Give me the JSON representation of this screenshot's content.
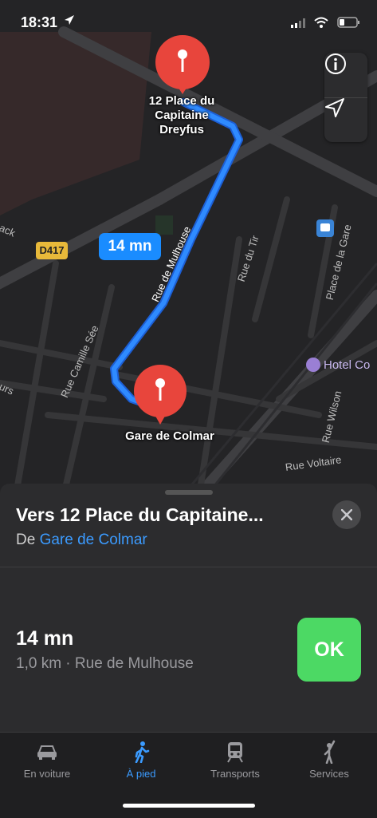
{
  "status_bar": {
    "time": "18:31"
  },
  "map": {
    "destination_pin_label": "12 Place du Capitaine Dreyfus",
    "destination_pin_lines": [
      "12 Place du",
      "Capitaine",
      "Dreyfus"
    ],
    "origin_pin_label": "Gare de Colmar",
    "route_time_bubble": "14 mn",
    "road_badge": "D417",
    "streets": {
      "rue_de_mulhouse": "Rue de Mulhouse",
      "rue_du_tir": "Rue du Tir",
      "place_de_la_gare": "Place de la Gare",
      "rue_camille_see": "Rue Camille Sée",
      "rue_wilson": "Rue Wilson",
      "rue_voltaire": "Rue Voltaire",
      "partial_left": "ack",
      "partial_left2": "urs"
    },
    "poi_hotel": "Hotel Co",
    "buttons": {
      "info_icon": "info-icon",
      "location_icon": "location-arrow-icon"
    }
  },
  "sheet": {
    "title": "Vers 12 Place du Capitaine...",
    "from_prefix": "De",
    "from_link": "Gare de Colmar",
    "duration": "14 mn",
    "detail": "1,0 km · Rue de Mulhouse",
    "ok_label": "OK"
  },
  "tabs": [
    {
      "label": "En voiture",
      "icon": "car-icon",
      "active": false
    },
    {
      "label": "À pied",
      "icon": "walk-icon",
      "active": true
    },
    {
      "label": "Transports",
      "icon": "train-icon",
      "active": false
    },
    {
      "label": "Services",
      "icon": "person-hailing-icon",
      "active": false
    }
  ],
  "colors": {
    "route": "#2f7fff",
    "pin": "#e8453c",
    "accent": "#3b9bff",
    "ok": "#4cd964"
  }
}
